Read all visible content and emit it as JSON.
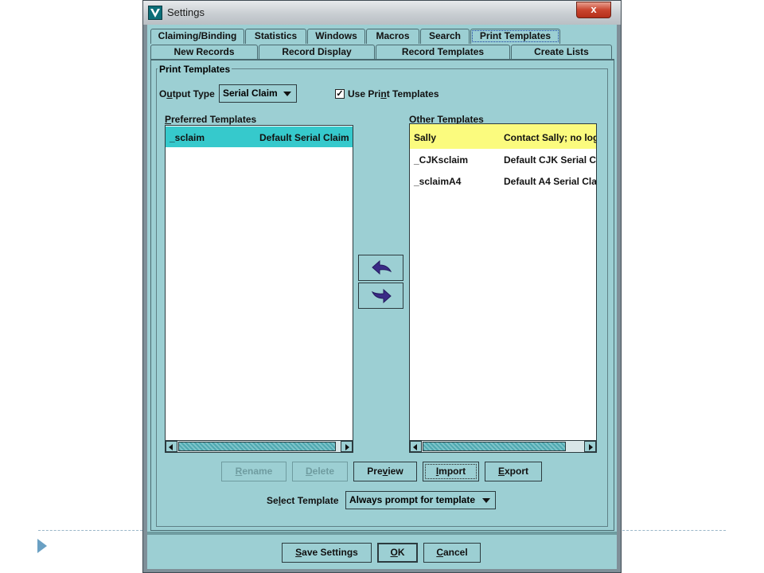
{
  "window": {
    "title": "Settings",
    "close_label": "x"
  },
  "tabs_row1": [
    "Claiming/Binding",
    "Statistics",
    "Windows",
    "Macros",
    "Search",
    "Print Templates"
  ],
  "tabs_row2": [
    "New Records",
    "Record Display",
    "Record Templates",
    "Create Lists"
  ],
  "active_tab": "Print Templates",
  "group": {
    "title": "Print Templates"
  },
  "output_type": {
    "label_pre": "O",
    "label_u": "u",
    "label_post": "tput Type",
    "value": "Serial Claim"
  },
  "use_print_templates": {
    "label_pre": "Use Pri",
    "label_u": "n",
    "label_post": "t Templates",
    "checked": true,
    "check_mark": "✓"
  },
  "preferred": {
    "label_u": "P",
    "label_post": "referred Templates",
    "rows": [
      {
        "name": "_sclaim",
        "desc": "Default Serial Claim",
        "selected": true
      }
    ]
  },
  "other": {
    "label_u": "O",
    "label_post": "ther Templates",
    "rows": [
      {
        "name": "Sally",
        "desc": "Contact Sally; no log"
      },
      {
        "name": "_CJKsclaim",
        "desc": "Default CJK Serial C"
      },
      {
        "name": "_sclaimA4",
        "desc": "Default A4 Serial Cla"
      }
    ]
  },
  "buttons": {
    "rename": {
      "u": "R",
      "rest": "ename"
    },
    "delete": {
      "u": "D",
      "rest": "elete"
    },
    "preview": {
      "pre": "Pre",
      "u": "v",
      "rest": "iew"
    },
    "import": {
      "u": "I",
      "rest": "mport"
    },
    "export": {
      "u": "E",
      "rest": "xport"
    }
  },
  "select_template": {
    "label_pre": "Se",
    "label_u": "l",
    "label_post": "ect Template",
    "value": "Always prompt for template"
  },
  "footer": {
    "save": {
      "u": "S",
      "rest": "ave Settings"
    },
    "ok": {
      "u": "O",
      "rest": "K"
    },
    "cancel": {
      "u": "C",
      "rest": "ancel"
    }
  },
  "colors": {
    "panel": "#9ccfd3",
    "selected_row": "#36c9cc",
    "highlight_row": "#fbfb7e"
  }
}
